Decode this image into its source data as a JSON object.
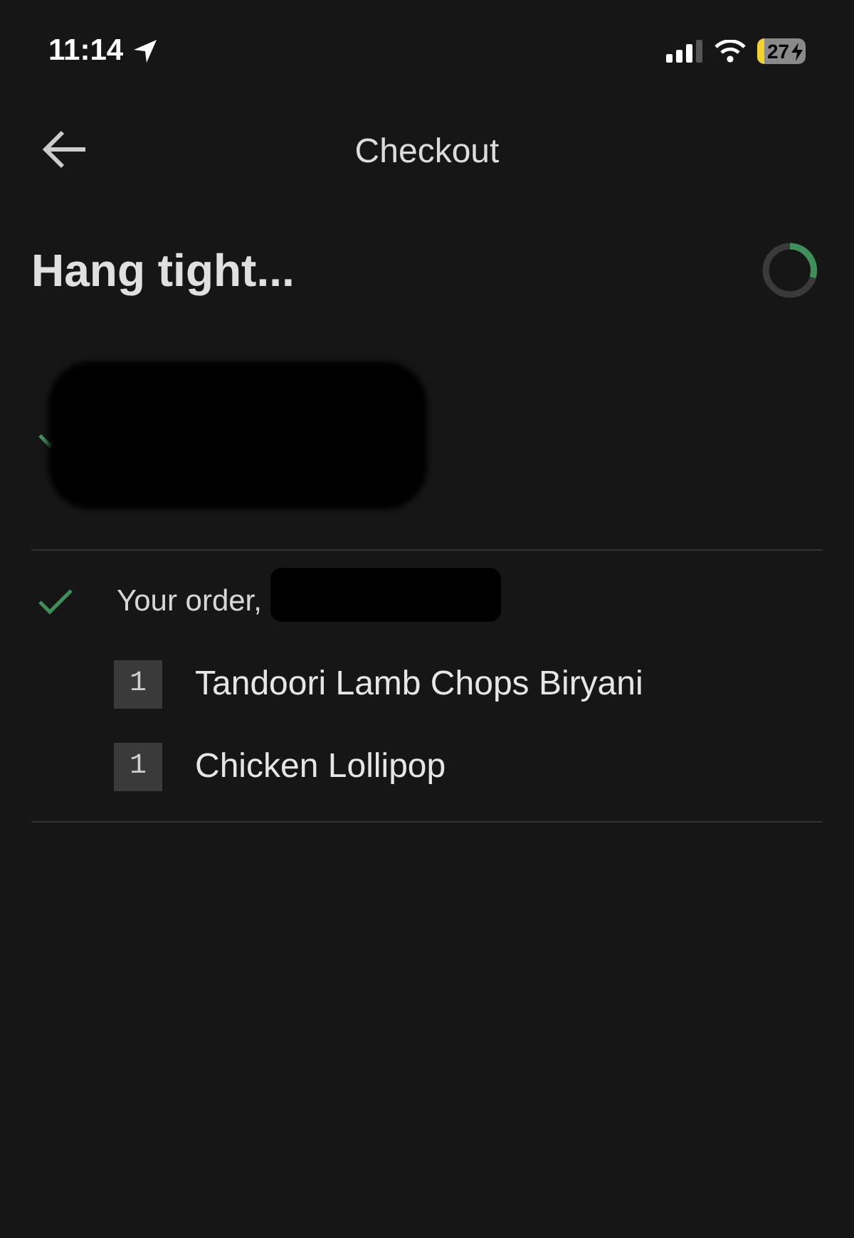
{
  "status_bar": {
    "time": "11:14",
    "battery": "27",
    "charging": true
  },
  "header": {
    "title": "Checkout"
  },
  "heading": "Hang tight...",
  "steps": [
    {
      "checked": true,
      "redacted": true
    },
    {
      "checked": true,
      "redacted": true,
      "text": "Your order,",
      "items": [
        {
          "quantity": "1",
          "name": "Tandoori Lamb Chops Biryani"
        },
        {
          "quantity": "1",
          "name": "Chicken Lollipop"
        }
      ]
    }
  ]
}
